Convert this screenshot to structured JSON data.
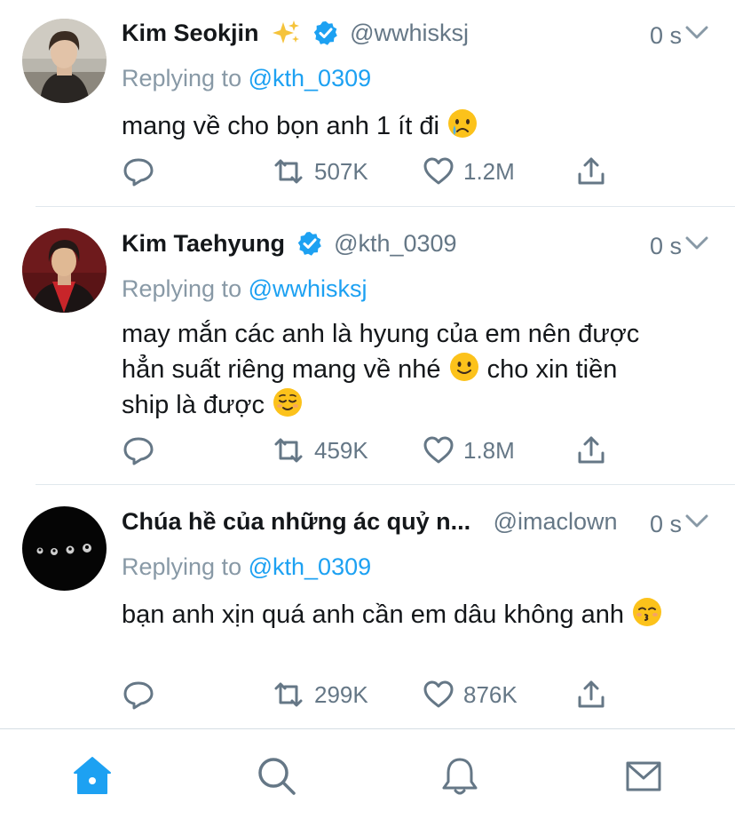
{
  "colors": {
    "accent": "#1da1f2",
    "verified": "#1da1f2",
    "secondary_text": "#657786",
    "divider": "#e1e8ed"
  },
  "tweets": [
    {
      "name": "Kim Seokjin",
      "name_emoji": "sparkles-icon",
      "verified": true,
      "handle": "@wwhisksj",
      "time": "0 s",
      "replying_label": "Replying to",
      "replying_to": "@kth_0309",
      "text": "mang về cho bọn anh 1 ít đi",
      "text_emoji": "crying-face-emoji",
      "retweets": "507K",
      "likes": "1.2M"
    },
    {
      "name": "Kim Taehyung",
      "verified": true,
      "handle": "@kth_0309",
      "time": "0 s",
      "replying_label": "Replying to",
      "replying_to": "@wwhisksj",
      "text_line1": "may mắn các anh là hyung của em nên được",
      "text_line2_a": "hẳn suất riêng mang về nhé",
      "text_line2_emoji": "slightly-smiling-face-emoji",
      "text_line2_b": "cho xin tiền",
      "text_line3": "ship là được",
      "text_line3_emoji": "relieved-face-emoji",
      "retweets": "459K",
      "likes": "1.8M"
    },
    {
      "name": "Chúa hề của những ác quỷ n...",
      "verified": false,
      "handle": "@imaclown",
      "time": "0 s",
      "replying_label": "Replying to",
      "replying_to": "@kth_0309",
      "text": "bạn anh xịn quá anh cần em dâu không anh",
      "text_emoji": "kissing-face-emoji",
      "retweets": "299K",
      "likes": "876K"
    }
  ],
  "tabbar": {
    "tabs": [
      "home-icon",
      "search-icon",
      "notifications-icon",
      "messages-icon"
    ],
    "active": "home-icon"
  }
}
